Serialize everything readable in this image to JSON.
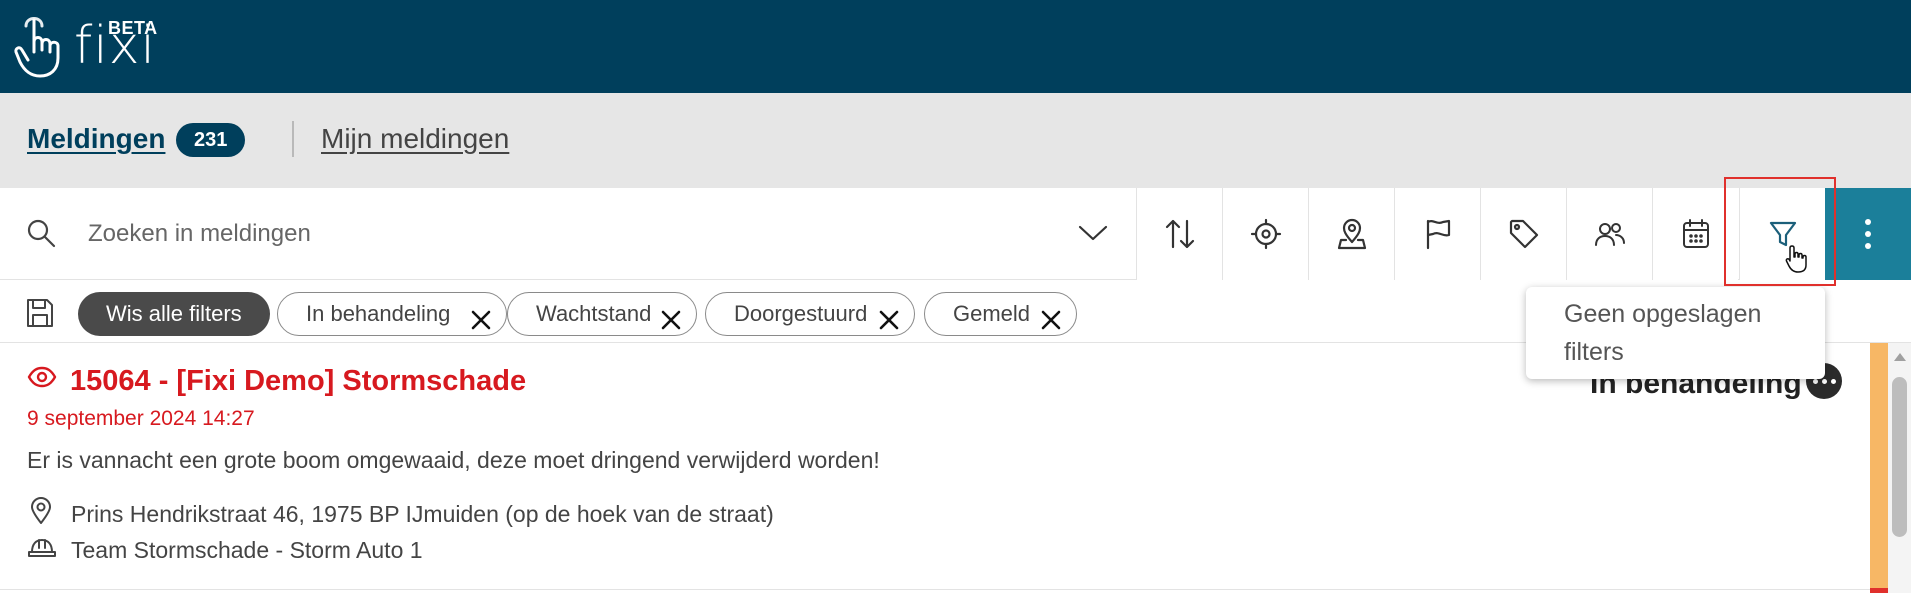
{
  "header": {
    "logo_text": "fixi",
    "logo_badge": "BETA"
  },
  "tabs": {
    "main_label": "Meldingen",
    "main_count": "231",
    "secondary_label": "Mijn meldingen"
  },
  "search": {
    "placeholder": "Zoeken in meldingen"
  },
  "toolbar": {
    "buttons": [
      {
        "name": "sort-button",
        "icon": "sort-arrows-icon"
      },
      {
        "name": "location-target-button",
        "icon": "crosshair-icon"
      },
      {
        "name": "map-pin-button",
        "icon": "map-pin-icon"
      },
      {
        "name": "flag-button",
        "icon": "flag-icon"
      },
      {
        "name": "tag-button",
        "icon": "tag-icon"
      },
      {
        "name": "people-button",
        "icon": "people-icon"
      },
      {
        "name": "calendar-button",
        "icon": "calendar-icon"
      },
      {
        "name": "filter-button",
        "icon": "filter-icon"
      }
    ]
  },
  "filters": {
    "clear_all_label": "Wis alle filters",
    "chips": [
      {
        "label": "In behandeling"
      },
      {
        "label": "Wachtstand"
      },
      {
        "label": "Doorgestuurd"
      },
      {
        "label": "Gemeld"
      }
    ]
  },
  "popover": {
    "text": "Geen opgeslagen filters"
  },
  "notifications": [
    {
      "title": "15064 - [Fixi Demo] Stormschade",
      "date": "9 september 2024 14:27",
      "description": "Er is vannacht een grote boom omgewaaid, deze moet dringend verwijderd worden!",
      "address": "Prins Hendrikstraat 46, 1975 BP IJmuiden (op de hoek van de straat)",
      "team": "Team Stormschade - Storm Auto 1",
      "status": "In behandeling"
    }
  ],
  "colors": {
    "header_bg": "#003f5c",
    "accent": "#1b7f9a",
    "title_red": "#d7191f",
    "status_stripe": "#f7b765",
    "highlight_red": "#e0302c"
  }
}
